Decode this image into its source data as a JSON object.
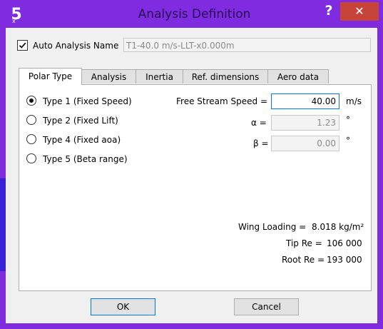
{
  "window": {
    "title": "Analysis Definition",
    "help_label": "?",
    "close_label": "✕",
    "app_icon_text": "5"
  },
  "auto_name": {
    "checked": true,
    "label": "Auto Analysis Name",
    "value": "T1-40.0 m/s-LLT-x0.000m"
  },
  "tabs": [
    {
      "label": "Polar Type",
      "active": true
    },
    {
      "label": "Analysis",
      "active": false
    },
    {
      "label": "Inertia",
      "active": false
    },
    {
      "label": "Ref. dimensions",
      "active": false
    },
    {
      "label": "Aero data",
      "active": false
    }
  ],
  "polar_types": [
    {
      "label": "Type 1 (Fixed Speed)",
      "selected": true
    },
    {
      "label": "Type 2 (Fixed Lift)",
      "selected": false
    },
    {
      "label": "Type 4 (Fixed aoa)",
      "selected": false
    },
    {
      "label": "Type 5 (Beta range)",
      "selected": false
    }
  ],
  "params": {
    "speed_label": "Free Stream Speed =",
    "speed_value": "40.00",
    "speed_unit": "m/s",
    "alpha_label": "α =",
    "alpha_value": "1.23",
    "alpha_unit": "°",
    "beta_label": "β =",
    "beta_value": "0.00",
    "beta_unit": "°"
  },
  "results": {
    "wing_loading_label": "Wing Loading =",
    "wing_loading_value": "8.018 kg/m²",
    "tip_re_label": "Tip Re =",
    "tip_re_value": "106 000",
    "root_re_label": "Root Re =",
    "root_re_value": "193 000"
  },
  "buttons": {
    "ok": "OK",
    "cancel": "Cancel"
  },
  "colors": {
    "frame": "#7f2ce0",
    "close": "#c7443b",
    "focus": "#0078d7"
  }
}
